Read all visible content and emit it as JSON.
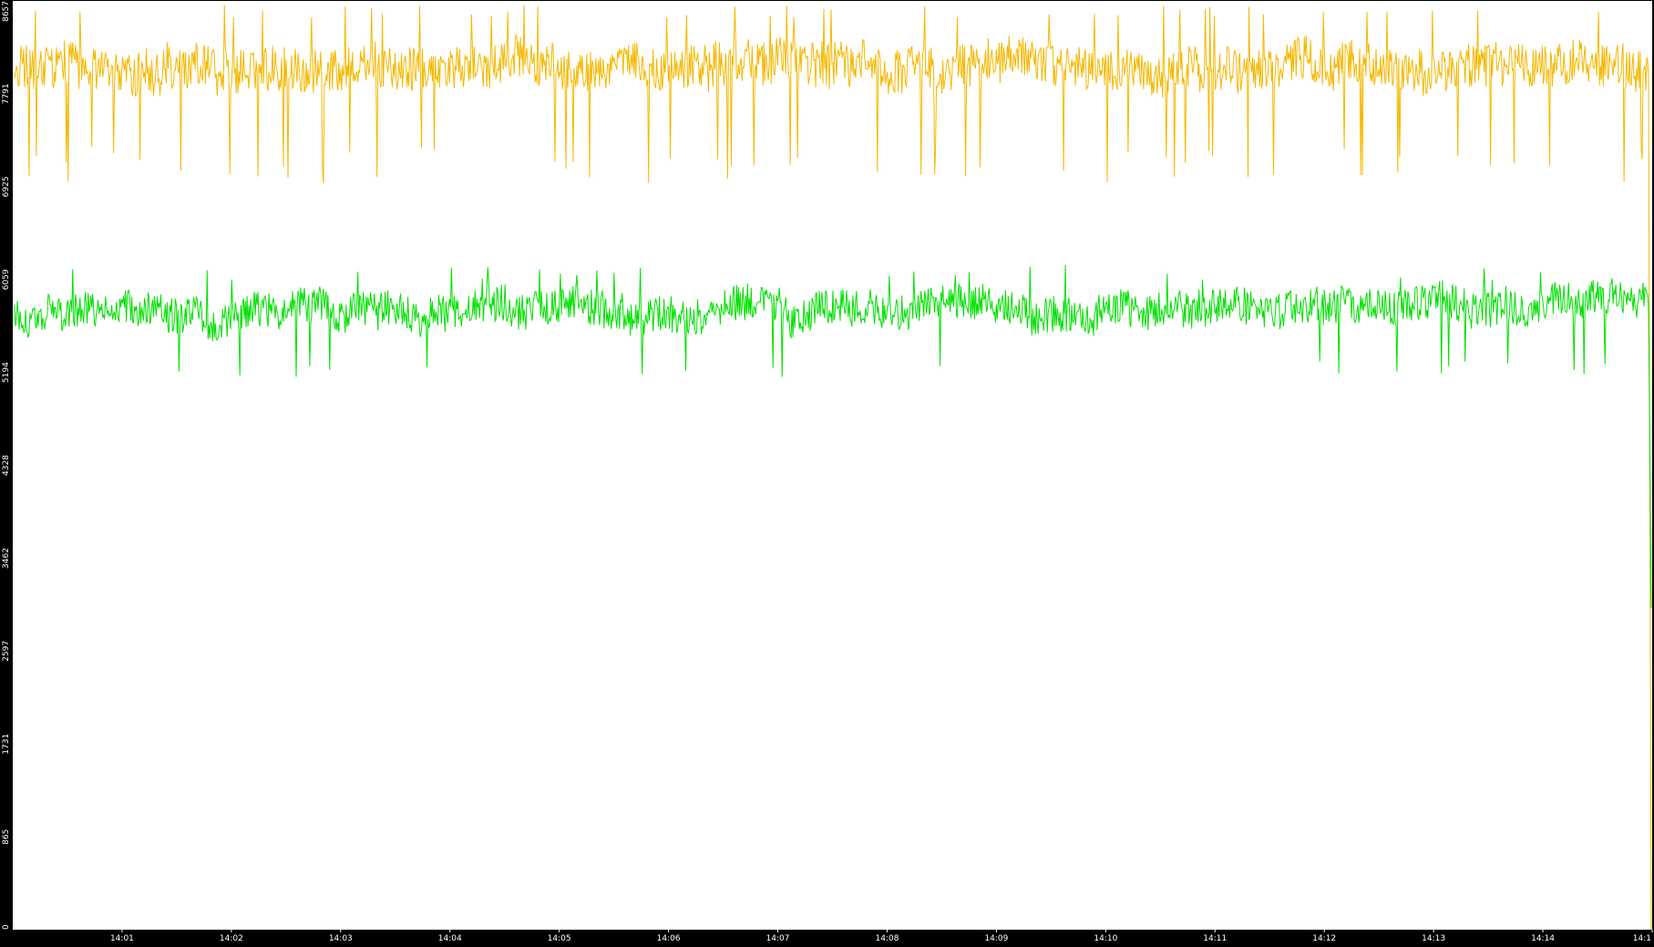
{
  "colors": {
    "background": "#000000",
    "plot_background": "#ffffff",
    "tick_text": "#ffffff",
    "series_yellow": "#f5b800",
    "series_green": "#00e000"
  },
  "chart_data": {
    "type": "line",
    "title": "",
    "xlabel": "",
    "ylabel": "",
    "ylim": [
      0,
      8657
    ],
    "y_ticks": [
      "0",
      "865",
      "1731",
      "2597",
      "3462",
      "4328",
      "5194",
      "6059",
      "6925",
      "7791",
      "8657"
    ],
    "x_tick_labels": [
      "14:01",
      "14:02",
      "14:03",
      "14:04",
      "14:05",
      "14:06",
      "14:07",
      "14:08",
      "14:09",
      "14:10",
      "14:11",
      "14:12",
      "14:13",
      "14:14",
      "14:1"
    ],
    "xlim_minutes": [
      "14:00:00",
      "14:15:00"
    ],
    "grid": false,
    "legend": "none",
    "series": [
      {
        "color": "#f5b800",
        "mean": 8050,
        "typical_min": 7300,
        "typical_max": 8500,
        "end_value": 0
      },
      {
        "color": "#00e000",
        "mean": 5720,
        "typical_min": 5300,
        "typical_max": 6050,
        "end_value": 3000
      }
    ]
  }
}
